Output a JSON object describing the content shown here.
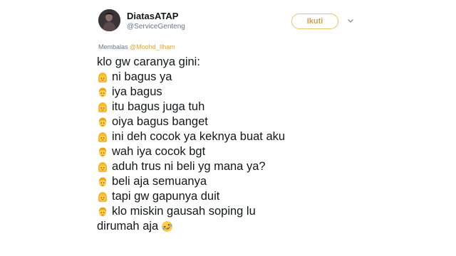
{
  "user": {
    "display_name": "DiatasATAP",
    "handle": "@ServiceGenteng"
  },
  "follow_button": {
    "label": "Ikuti"
  },
  "reply": {
    "prefix": "Membalas",
    "mention": "@Moohd_Ilham"
  },
  "tweet": {
    "intro": "klo gw caranya gini:",
    "lines": [
      {
        "icon": "girl-blonde-face-icon",
        "text": "ni bagus ya"
      },
      {
        "icon": "man-blonde-face-icon",
        "text": "iya bagus"
      },
      {
        "icon": "girl-blonde-face-icon",
        "text": "itu bagus juga tuh"
      },
      {
        "icon": "man-blonde-face-icon",
        "text": "oiya bagus banget"
      },
      {
        "icon": "girl-blonde-face-icon",
        "text": "ini deh cocok ya keknya buat aku"
      },
      {
        "icon": "man-blonde-face-icon",
        "text": "wah iya cocok bgt"
      },
      {
        "icon": "girl-blonde-face-icon",
        "text": "aduh trus ni beli yg mana ya?"
      },
      {
        "icon": "man-blonde-face-icon",
        "text": "beli aja semuanya"
      },
      {
        "icon": "girl-blonde-face-icon",
        "text": "tapi gw gapunya duit"
      },
      {
        "icon": "man-blonde-face-icon",
        "text": "klo miskin gausah soping lu"
      }
    ],
    "outro": "dirumah aja",
    "outro_icon": "rolling-laughing-face-icon"
  },
  "colors": {
    "accent": "#e3a33a",
    "follow_border": "#e8c66b",
    "text": "#14171a",
    "muted": "#657786"
  }
}
